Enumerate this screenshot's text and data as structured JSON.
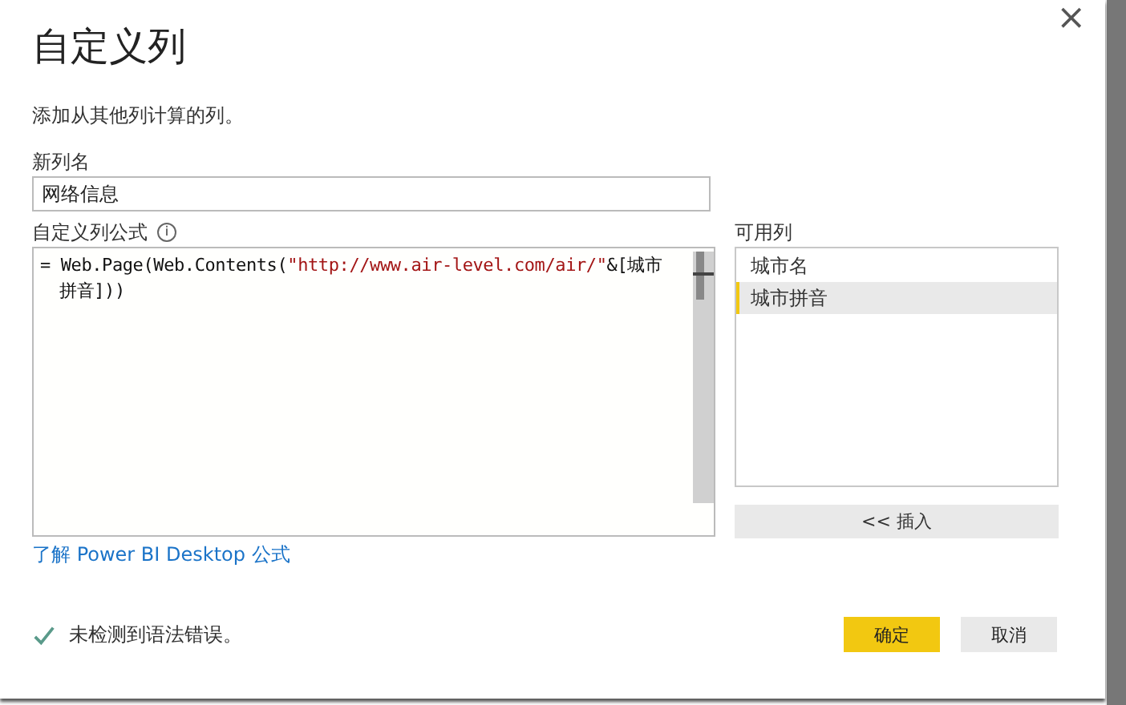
{
  "dialog": {
    "title": "自定义列",
    "close": "×",
    "subtitle": "添加从其他列计算的列。"
  },
  "new_column": {
    "label": "新列名",
    "value": "网络信息"
  },
  "formula": {
    "label": "自定义列公式",
    "info": "i",
    "segments": [
      {
        "text": "= Web.Page(Web.Contents(",
        "kind": "code"
      },
      {
        "text": "\"http://www.air-level.com/air/\"",
        "kind": "string"
      },
      {
        "text": "&[城市拼音])",
        "kind": "code"
      },
      {
        "text": ")",
        "kind": "code"
      }
    ]
  },
  "available_columns": {
    "label": "可用列",
    "items": [
      {
        "label": "城市名",
        "selected": false
      },
      {
        "label": "城市拼音",
        "selected": true
      }
    ],
    "insert_button": "<< 插入"
  },
  "help_link": "了解 Power BI Desktop 公式",
  "status": {
    "ok": true,
    "text": "未检测到语法错误。"
  },
  "buttons": [
    {
      "label": "确定",
      "kind": "primary"
    },
    {
      "label": "取消",
      "kind": "secondary"
    }
  ]
}
